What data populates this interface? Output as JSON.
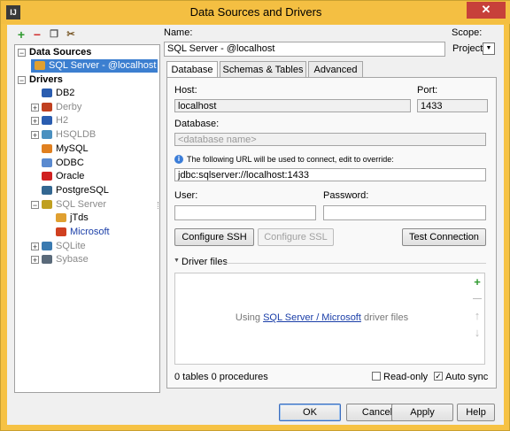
{
  "window": {
    "title": "Data Sources and Drivers",
    "close_glyph": "✕",
    "app_icon_text": "IJ"
  },
  "toolbar": {
    "add_glyph": "+",
    "remove_glyph": "−",
    "copy_glyph": "❐",
    "settings_glyph": "✂"
  },
  "tree": {
    "data_sources_header": "Data Sources",
    "selected_source": "SQL Server - @localhost",
    "drivers_header": "Drivers",
    "drivers": [
      {
        "label": "DB2",
        "dim": false,
        "color": "#2a5db0"
      },
      {
        "label": "Derby",
        "dim": true,
        "color": "#c04020"
      },
      {
        "label": "H2",
        "dim": true,
        "color": "#2a5db0"
      },
      {
        "label": "HSQLDB",
        "dim": true,
        "color": "#4a90c0"
      },
      {
        "label": "MySQL",
        "dim": false,
        "color": "#e08020"
      },
      {
        "label": "ODBC",
        "dim": false,
        "color": "#5a8ad0"
      },
      {
        "label": "Oracle",
        "dim": false,
        "color": "#d02020"
      },
      {
        "label": "PostgreSQL",
        "dim": false,
        "color": "#336791"
      },
      {
        "label": "SQL Server",
        "dim": true,
        "color": "#c0a020"
      },
      {
        "label": "jTds",
        "dim": false,
        "color": "#e0a030"
      },
      {
        "label": "Microsoft",
        "dim": false,
        "color": "#d04020"
      },
      {
        "label": "SQLite",
        "dim": true,
        "color": "#3a7ab0"
      },
      {
        "label": "Sybase",
        "dim": true,
        "color": "#5a6a7a"
      }
    ]
  },
  "form": {
    "name_label": "Name:",
    "name_value": "SQL Server - @localhost",
    "scope_label": "Scope:",
    "scope_value": "Project",
    "scope_arrow": "▼"
  },
  "tabs": [
    "Database",
    "Schemas & Tables",
    "Advanced"
  ],
  "database_tab": {
    "host_label": "Host:",
    "host_value": "localhost",
    "port_label": "Port:",
    "port_value": "1433",
    "database_label": "Database:",
    "database_placeholder": "<database name>",
    "info_text": "The following URL will be used to connect, edit to override:",
    "info_glyph": "i",
    "url_value": "jdbc:sqlserver://localhost:1433",
    "user_label": "User:",
    "user_value": "",
    "password_label": "Password:",
    "password_value": "",
    "configure_ssh": "Configure SSH",
    "configure_ssl": "Configure SSL",
    "test_connection": "Test Connection",
    "driver_files_label": "Driver files",
    "driver_files_arrow": "▼",
    "driver_text_before": "Using ",
    "driver_link": "SQL Server / Microsoft",
    "driver_text_after": " driver files",
    "side_add": "+",
    "side_remove": "—",
    "side_up": "↑",
    "side_down": "↓",
    "status_text": "0 tables 0 procedures",
    "readonly_label": "Read-only",
    "readonly_checked": false,
    "autosync_label": "Auto sync",
    "autosync_checked": true,
    "check_glyph": "✓"
  },
  "footer": {
    "ok": "OK",
    "cancel": "Cancel",
    "apply": "Apply",
    "help": "Help"
  }
}
